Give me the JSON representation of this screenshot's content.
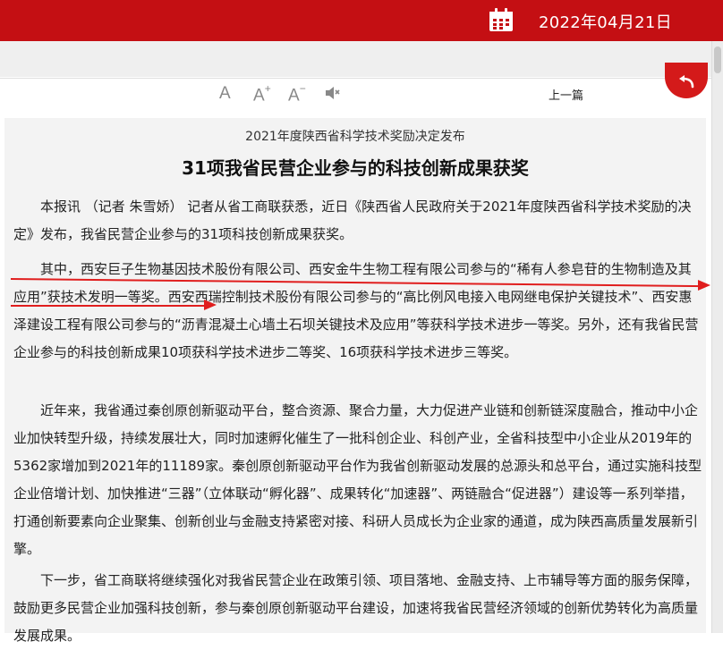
{
  "header": {
    "date": "2022年04月21日",
    "calendar_icon": "calendar-icon"
  },
  "toolbar": {
    "font_normal": "A",
    "font_larger": "A",
    "font_larger_sup": "+",
    "font_smaller": "A",
    "font_smaller_sup": "−",
    "speaker_icon": "speaker-icon",
    "prev_label": "上一篇",
    "back_icon": "return-arrow-icon"
  },
  "article": {
    "subhead": "2021年度陕西省科学技术奖励决定发布",
    "headline": "31项我省民营企业参与的科技创新成果获奖",
    "paragraphs": [
      "本报讯 （记者 朱雪娇） 记者从省工商联获悉，近日《陕西省人民政府关于2021年度陕西省科学技术奖励的决定》发布，我省民营企业参与的31项科技创新成果获奖。",
      "其中，西安巨子生物基因技术股份有限公司、西安金牛生物工程有限公司参与的“稀有人参皂苷的生物制造及其应用”获技术发明一等奖。西安西瑞控制技术股份有限公司参与的“高比例风电接入电网继电保护关键技术”、西安惠泽建设工程有限公司参与的“沥青混凝土心墙土石坝关键技术及应用”等获科学技术进步一等奖。另外，还有我省民营企业参与的科技创新成果10项获科学技术进步二等奖、16项获科学技术进步三等奖。",
      "近年来，我省通过秦创原创新驱动平台，整合资源、聚合力量，大力促进产业链和创新链深度融合，推动中小企业加快转型升级，持续发展壮大，同时加速孵化催生了一批科创企业、科创产业，全省科技型中小企业从2019年的5362家增加到2021年的11189家。秦创原创新驱动平台作为我省创新驱动发展的总源头和总平台，通过实施科技型企业倍增计划、加快推进“三器”（立体联动“孵化器”、成果转化“加速器”、两链融合“促进器”）建设等一系列举措，打通创新要素向企业聚集、创新创业与金融支持紧密对接、科研人员成长为企业家的通道，成为陕西高质量发展新引擎。",
      "下一步，省工商联将继续强化对我省民营企业在政策引领、项目落地、金融支持、上市辅导等方面的服务保障，鼓励更多民营企业加强科技创新，参与秦创原创新驱动平台建设，加速将我省民营经济领域的创新优势转化为高质量发展成果。"
    ]
  },
  "colors": {
    "brand_red": "#c40f13",
    "annotation_red": "#e01e1e"
  }
}
